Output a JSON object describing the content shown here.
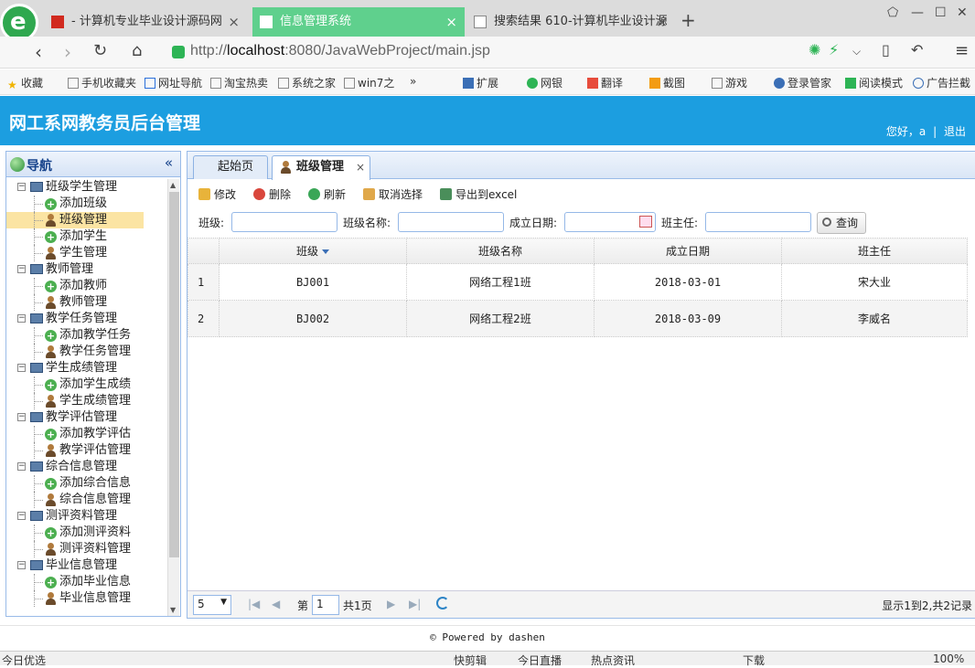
{
  "browser": {
    "tabs": [
      {
        "label": "- 计算机专业毕业设计源码网"
      },
      {
        "label": "信息管理系统"
      },
      {
        "label": "搜索结果 610-计算机毕业设计源"
      }
    ],
    "url_prefix": "http://",
    "url_host": "localhost",
    "url_rest": ":8080/JavaWebProject/main.jsp",
    "bookmarks": [
      "收藏",
      "手机收藏夹",
      "网址导航",
      "淘宝热卖",
      "系统之家",
      "win7之",
      "扩展",
      "网银",
      "翻译",
      "截图",
      "游戏",
      "登录管家",
      "阅读模式",
      "广告拦截"
    ]
  },
  "header": {
    "title": "网工系网教务员后台管理",
    "greeting": "您好，a",
    "logout": "退出"
  },
  "sidebar": {
    "title": "导航",
    "groups": [
      {
        "label": "班级学生管理",
        "children": [
          "添加班级",
          "班级管理",
          "添加学生",
          "学生管理"
        ]
      },
      {
        "label": "教师管理",
        "children": [
          "添加教师",
          "教师管理"
        ]
      },
      {
        "label": "教学任务管理",
        "children": [
          "添加教学任务",
          "教学任务管理"
        ]
      },
      {
        "label": "学生成绩管理",
        "children": [
          "添加学生成绩",
          "学生成绩管理"
        ]
      },
      {
        "label": "教学评估管理",
        "children": [
          "添加教学评估",
          "教学评估管理"
        ]
      },
      {
        "label": "综合信息管理",
        "children": [
          "添加综合信息",
          "综合信息管理"
        ]
      },
      {
        "label": "测评资料管理",
        "children": [
          "添加测评资料",
          "测评资料管理"
        ]
      },
      {
        "label": "毕业信息管理",
        "children": [
          "添加毕业信息",
          "毕业信息管理"
        ]
      }
    ]
  },
  "main": {
    "tabs": [
      "起始页",
      "班级管理"
    ],
    "toolbar": {
      "edit": "修改",
      "delete": "删除",
      "refresh": "刷新",
      "deselect": "取消选择",
      "export": "导出到excel"
    },
    "filters": {
      "class_label": "班级:",
      "class_name_label": "班级名称:",
      "date_label": "成立日期:",
      "teacher_label": "班主任:",
      "query": "查询"
    },
    "table": {
      "columns": [
        "班级",
        "班级名称",
        "成立日期",
        "班主任"
      ],
      "rows": [
        {
          "num": "1",
          "code": "BJ001",
          "name": "网络工程1班",
          "date": "2018-03-01",
          "teacher": "宋大业"
        },
        {
          "num": "2",
          "code": "BJ002",
          "name": "网络工程2班",
          "date": "2018-03-09",
          "teacher": "李威名"
        }
      ]
    },
    "pager": {
      "page_size": "5",
      "page_label_pre": "第",
      "page_value": "1",
      "page_label_post": "共1页",
      "info": "显示1到2,共2记录"
    }
  },
  "footer": "Powered by dashen",
  "statusbar": [
    "今日优选",
    "快剪辑",
    "今日直播",
    "热点资讯",
    "下载",
    "100%"
  ],
  "colors": {
    "header": "#1c9ee0",
    "active_tab": "#5fd08d",
    "selected_row": "#fbe4a3"
  }
}
